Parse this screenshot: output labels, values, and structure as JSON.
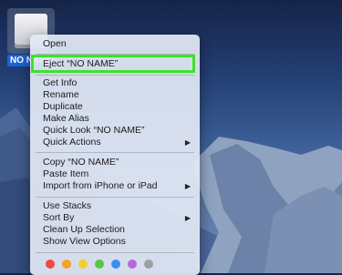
{
  "desktop": {
    "drive_name": "NO NAME"
  },
  "context_menu": {
    "open": "Open",
    "eject": "Eject “NO NAME”",
    "get_info": "Get Info",
    "rename": "Rename",
    "duplicate": "Duplicate",
    "make_alias": "Make Alias",
    "quick_look": "Quick Look “NO NAME”",
    "quick_actions": "Quick Actions",
    "copy": "Copy “NO NAME”",
    "paste_item": "Paste Item",
    "import_iphone": "Import from iPhone or iPad",
    "use_stacks": "Use Stacks",
    "sort_by": "Sort By",
    "clean_up": "Clean Up Selection",
    "show_view_options": "Show View Options",
    "submenu_arrow": "▶",
    "tags": [
      {
        "name": "red-tag",
        "color": "#ee4b43"
      },
      {
        "name": "orange-tag",
        "color": "#f5a122"
      },
      {
        "name": "yellow-tag",
        "color": "#f3cf2c"
      },
      {
        "name": "green-tag",
        "color": "#59c641"
      },
      {
        "name": "blue-tag",
        "color": "#3a8ef2"
      },
      {
        "name": "purple-tag",
        "color": "#b56bd8"
      },
      {
        "name": "gray-tag",
        "color": "#a0a0a4"
      }
    ]
  },
  "annotation": {
    "highlight_color": "#3ce22c",
    "highlight_target": "eject"
  }
}
